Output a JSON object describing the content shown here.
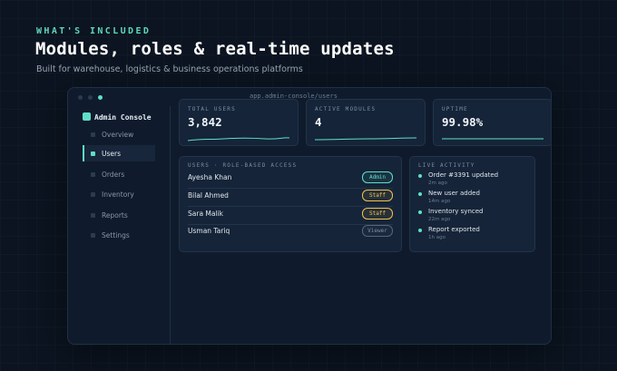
{
  "hero": {
    "eyebrow": "WHAT'S INCLUDED",
    "title": "Modules, roles & real-time updates",
    "subtitle": "Built for warehouse, logistics & business operations platforms"
  },
  "window": {
    "url": "app.admin-console/users"
  },
  "sidebar": {
    "brand": "Admin Console",
    "items": [
      {
        "label": "Overview",
        "active": false
      },
      {
        "label": "Users",
        "active": true
      },
      {
        "label": "Orders",
        "active": false
      },
      {
        "label": "Inventory",
        "active": false
      },
      {
        "label": "Reports",
        "active": false
      },
      {
        "label": "Settings",
        "active": false
      }
    ]
  },
  "stats": [
    {
      "label": "TOTAL USERS",
      "value": "3,842"
    },
    {
      "label": "ACTIVE MODULES",
      "value": "4"
    },
    {
      "label": "UPTIME",
      "value": "99.98%"
    }
  ],
  "users_panel": {
    "title": "USERS · ROLE-BASED ACCESS",
    "rows": [
      {
        "name": "Ayesha Khan",
        "role": "Admin"
      },
      {
        "name": "Bilal Ahmed",
        "role": "Staff"
      },
      {
        "name": "Sara Malik",
        "role": "Staff"
      },
      {
        "name": "Usman Tariq",
        "role": "Viewer"
      }
    ]
  },
  "activity_panel": {
    "title": "LIVE ACTIVITY",
    "items": [
      {
        "text": "Order #3391 updated",
        "time": "2m ago"
      },
      {
        "text": "New user added",
        "time": "14m ago"
      },
      {
        "text": "Inventory synced",
        "time": "22m ago"
      },
      {
        "text": "Report exported",
        "time": "1h ago"
      }
    ]
  },
  "colors": {
    "accent": "#5fe0c6",
    "staff": "#f2c14e",
    "viewer": "#7f8da1",
    "background": "#0b1420"
  }
}
